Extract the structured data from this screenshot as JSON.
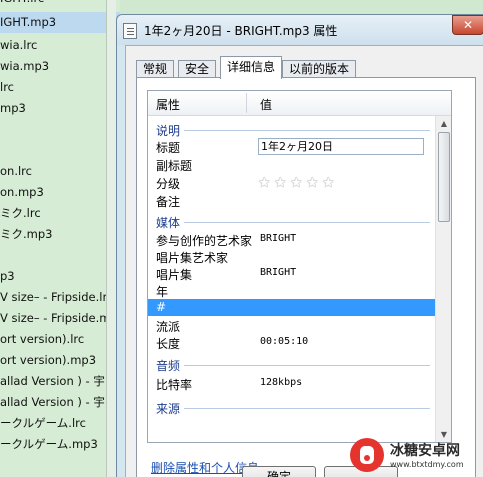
{
  "background_list": {
    "items": [
      "IGHT.mp3",
      "wia.lrc",
      "wia.mp3",
      "lrc",
      "mp3",
      "",
      "",
      "on.lrc",
      "on.mp3",
      "ミク.lrc",
      "ミク.mp3",
      "",
      "p3",
      "V  size– - Fripside.lrc",
      "V  size– - Fripside.mp3",
      "ort version).lrc",
      "ort version).mp3",
      "allad  Version ) - 宇",
      "allad  Version ) - 宇",
      "ークルゲーム.lrc",
      "ークルゲーム.mp3"
    ],
    "top_partial": "IGHT.lrc"
  },
  "dialog": {
    "title": "1年2ヶ月20日 - BRIGHT.mp3 属性",
    "close_label": "✕",
    "tabs": [
      "常规",
      "安全",
      "详细信息",
      "以前的版本"
    ],
    "active_tab": "详细信息",
    "grid": {
      "header_property": "属性",
      "header_value": "值",
      "groups": [
        {
          "name": "说明",
          "rows": [
            {
              "key": "标题",
              "value": "1年2ヶ月20日"
            },
            {
              "key": "副标题",
              "value": ""
            },
            {
              "key": "分级",
              "value": ""
            },
            {
              "key": "备注",
              "value": ""
            }
          ]
        },
        {
          "name": "媒体",
          "rows": [
            {
              "key": "参与创作的艺术家",
              "value": "BRIGHT"
            },
            {
              "key": "唱片集艺术家",
              "value": ""
            },
            {
              "key": "唱片集",
              "value": "BRIGHT"
            },
            {
              "key": "年",
              "value": ""
            },
            {
              "key": "#",
              "value": ""
            },
            {
              "key": "流派",
              "value": ""
            },
            {
              "key": "长度",
              "value": "00:05:10"
            }
          ]
        },
        {
          "name": "音频",
          "rows": [
            {
              "key": "比特率",
              "value": "128kbps"
            }
          ]
        },
        {
          "name": "来源",
          "rows": []
        }
      ],
      "rating_stars": 5,
      "rating_value": 0,
      "selected_row": "#"
    },
    "remove_link": "删除属性和个人信息",
    "ok_button": "确定",
    "cancel_button": ""
  },
  "watermark": {
    "name": "冰糖安卓网",
    "url": "www.btxtdmy.com"
  }
}
